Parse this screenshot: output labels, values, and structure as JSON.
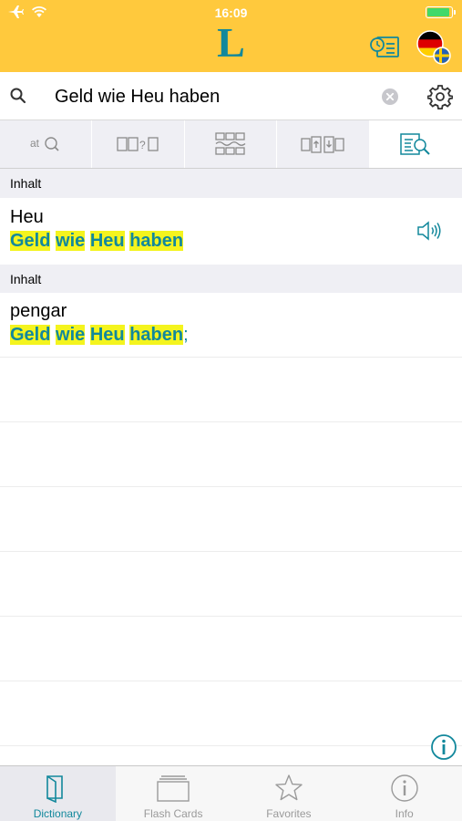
{
  "status_bar": {
    "time": "16:09",
    "icons": [
      "airplane-icon",
      "wifi-icon",
      "battery-icon"
    ]
  },
  "header": {
    "logo": "L",
    "buttons": [
      "history-icon",
      "language-flag-icon"
    ]
  },
  "search": {
    "query": "Geld wie Heu haben",
    "placeholder": ""
  },
  "mode_tabs": [
    {
      "icon": "autocomplete-icon",
      "active": false
    },
    {
      "icon": "wildcard-search-icon",
      "active": false
    },
    {
      "icon": "fuzzy-search-icon",
      "active": false
    },
    {
      "icon": "reverse-search-icon",
      "active": false
    },
    {
      "icon": "fulltext-search-icon",
      "active": true
    }
  ],
  "results": [
    {
      "section": "Inhalt",
      "word": "Heu",
      "translation": [
        "Geld",
        "wie",
        "Heu",
        "haben"
      ],
      "suffix": "",
      "has_audio": true
    },
    {
      "section": "Inhalt",
      "word": "pengar",
      "translation": [
        "Geld",
        "wie",
        "Heu",
        "haben"
      ],
      "suffix": ";",
      "has_audio": false
    }
  ],
  "tabbar": {
    "tabs": [
      {
        "label": "Dictionary",
        "icon": "book-icon",
        "active": true
      },
      {
        "label": "Flash Cards",
        "icon": "flashcards-icon",
        "active": false
      },
      {
        "label": "Favorites",
        "icon": "star-icon",
        "active": false
      },
      {
        "label": "Info",
        "icon": "info-icon",
        "active": false
      }
    ]
  },
  "colors": {
    "header": "#FFC93D",
    "accent": "#12889C",
    "highlight": "#F4F41E",
    "battery": "#41D96A"
  }
}
